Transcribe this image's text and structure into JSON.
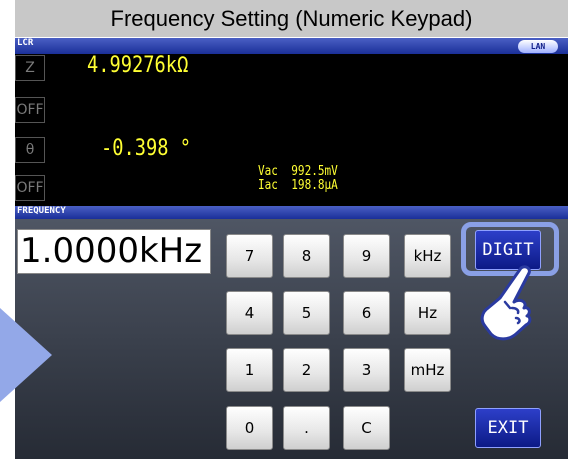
{
  "title": "Frequency Setting (Numeric Keypad)",
  "status": {
    "mode": "LCR",
    "lan": "LAN"
  },
  "params": [
    {
      "label": "Z",
      "value": "4.99276kΩ"
    },
    {
      "label": "OFF"
    },
    {
      "label": "θ",
      "value": "-0.398 °"
    },
    {
      "label": "OFF"
    }
  ],
  "monitor": {
    "vac_label": "Vac",
    "vac_value": "992.5mV",
    "iac_label": "Iac",
    "iac_value": "198.8μA"
  },
  "frequency": {
    "label": "FREQUENCY",
    "value": "1.0000kHz"
  },
  "keypad": [
    [
      "7",
      "8",
      "9",
      "kHz"
    ],
    [
      "4",
      "5",
      "6",
      "Hz"
    ],
    [
      "1",
      "2",
      "3",
      "mHz"
    ],
    [
      "0",
      ".",
      "C"
    ]
  ],
  "buttons": {
    "digit": "DIGIT",
    "exit": "EXIT"
  },
  "colors": {
    "measurement": "#ffff33",
    "header_bar": "#1a2f99",
    "button": "#0c1a86"
  }
}
